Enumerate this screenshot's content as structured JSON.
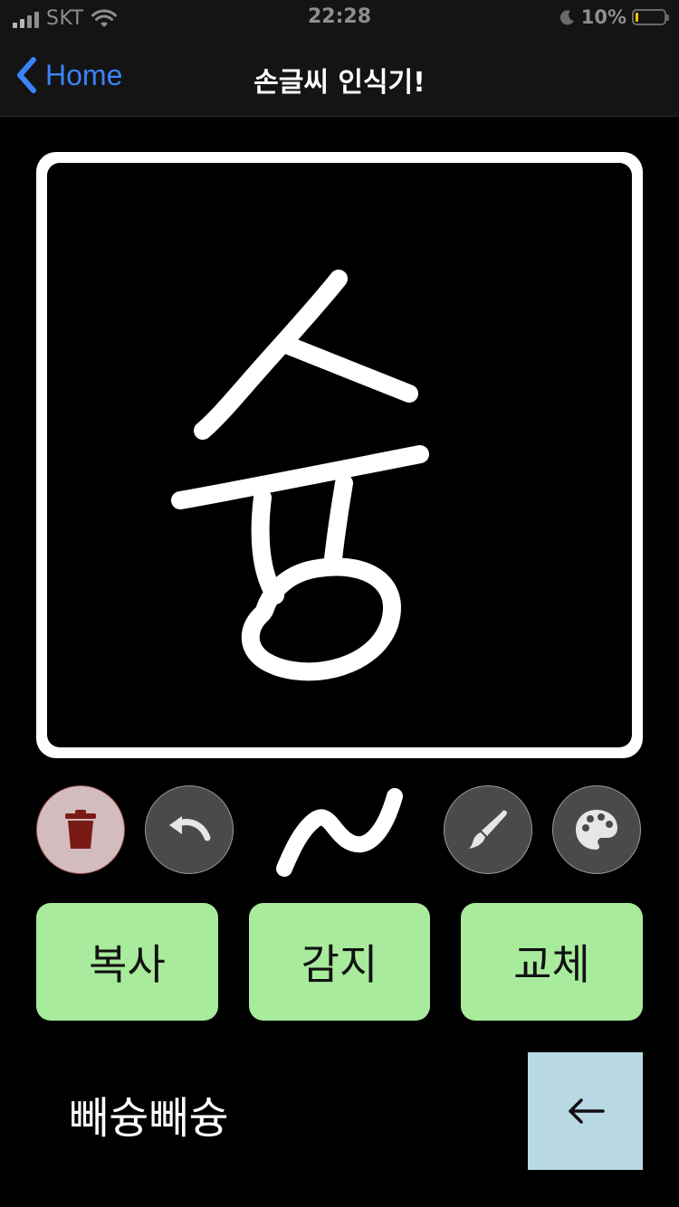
{
  "status_bar": {
    "carrier": "SKT",
    "time": "22:28",
    "battery_percent": "10%",
    "battery_level": 0.1,
    "icons": [
      "signal-icon",
      "wifi-icon",
      "moon-icon",
      "battery-icon"
    ]
  },
  "nav": {
    "back_label": "Home",
    "title": "손글씨 인식기!",
    "accent_color": "#3b82f6"
  },
  "canvas": {
    "background": "#000000",
    "frame_color": "#ffffff",
    "stroke_color": "#ffffff",
    "drawn_character": "슝"
  },
  "tools": {
    "trash_icon": "trash-icon",
    "undo_icon": "undo-icon",
    "stroke_preview_icon": "stroke-preview-icon",
    "brush_icon": "brush-icon",
    "palette_icon": "palette-icon",
    "trash_color": "#7a1a14"
  },
  "actions": {
    "copy_label": "복사",
    "detect_label": "감지",
    "replace_label": "교체",
    "button_color": "#a8eb9c"
  },
  "result": {
    "text": "빼슝빼슝",
    "backspace_icon": "backspace-arrow-icon",
    "backspace_color": "#b8d8e4"
  }
}
